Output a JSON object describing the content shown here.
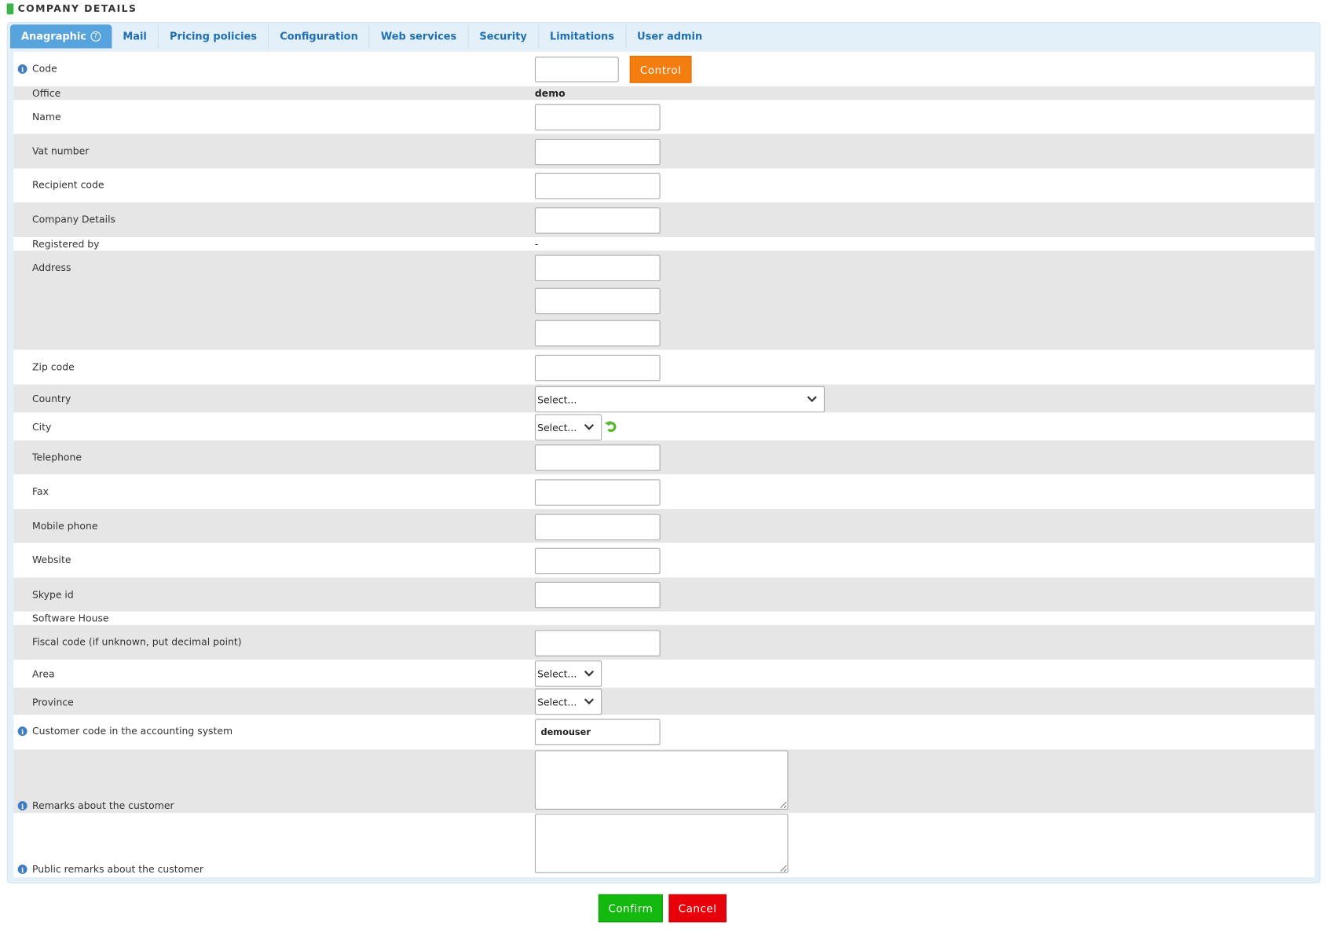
{
  "header": {
    "title": "COMPANY DETAILS",
    "marker_color": "#3bb54a"
  },
  "tabs": [
    {
      "label": "Anagraphic",
      "active": true,
      "help_icon": "?"
    },
    {
      "label": "Mail"
    },
    {
      "label": "Pricing policies"
    },
    {
      "label": "Configuration"
    },
    {
      "label": "Web services"
    },
    {
      "label": "Security"
    },
    {
      "label": "Limitations"
    },
    {
      "label": "User admin"
    }
  ],
  "form": {
    "code": {
      "label": "Code",
      "value": "",
      "button": "Control",
      "info_icon": "i"
    },
    "office": {
      "label": "Office",
      "value": "demo"
    },
    "name": {
      "label": "Name",
      "value": ""
    },
    "vat_number": {
      "label": "Vat number",
      "value": ""
    },
    "recipient_code": {
      "label": "Recipient code",
      "value": ""
    },
    "company_details": {
      "label": "Company Details",
      "value": ""
    },
    "registered_by": {
      "label": "Registered by",
      "value": "-"
    },
    "address": {
      "label": "Address",
      "lines": [
        "",
        "",
        ""
      ]
    },
    "zip_code": {
      "label": "Zip code",
      "value": ""
    },
    "country": {
      "label": "Country",
      "selected": "Select..."
    },
    "city": {
      "label": "City",
      "selected": "Select..."
    },
    "telephone": {
      "label": "Telephone",
      "value": ""
    },
    "fax": {
      "label": "Fax",
      "value": ""
    },
    "mobile_phone": {
      "label": "Mobile phone",
      "value": ""
    },
    "website": {
      "label": "Website",
      "value": ""
    },
    "skype_id": {
      "label": "Skype id",
      "value": ""
    },
    "software_house": {
      "label": "Software House",
      "value": ""
    },
    "fiscal_code": {
      "label": "Fiscal code (if unknown, put decimal point)",
      "value": ""
    },
    "area": {
      "label": "Area",
      "selected": "Select..."
    },
    "province": {
      "label": "Province",
      "selected": "Select..."
    },
    "customer_code": {
      "label": "Customer code in the accounting system",
      "value": "demouser",
      "info_icon": "i"
    },
    "remarks": {
      "label": "Remarks about the customer",
      "value": "",
      "info_icon": "i"
    },
    "public_remarks": {
      "label": "Public remarks about the customer",
      "value": "",
      "info_icon": "i"
    }
  },
  "actions": {
    "confirm": "Confirm",
    "cancel": "Cancel"
  },
  "colors": {
    "tab_active": "#56a3dd",
    "tab_text": "#1f6fb2",
    "control": "#f47d10",
    "confirm": "#14b90f",
    "cancel": "#e8000b",
    "alt_row": "#e6e6e6"
  }
}
